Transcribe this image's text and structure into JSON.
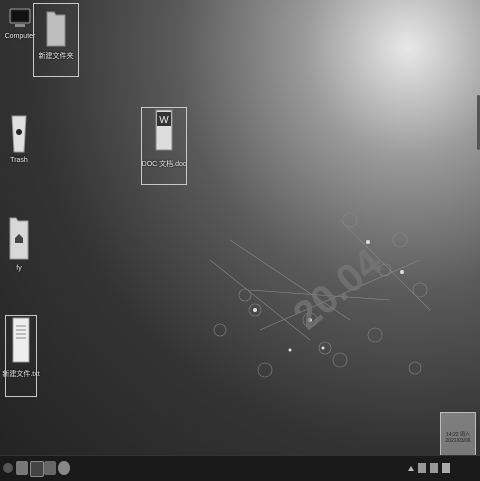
{
  "desktop": {
    "icons": [
      {
        "label": "Computer"
      },
      {
        "label": "新建文件夹"
      },
      {
        "label": "Trash"
      },
      {
        "label": "DOC 文档.doc"
      },
      {
        "label": "fy"
      },
      {
        "label": "新建文件.txt"
      }
    ]
  },
  "wallpaper": {
    "version_text": "20.04"
  },
  "taskbar": {
    "clock_time": "14:22 周六",
    "clock_date": "2021/03/06"
  }
}
